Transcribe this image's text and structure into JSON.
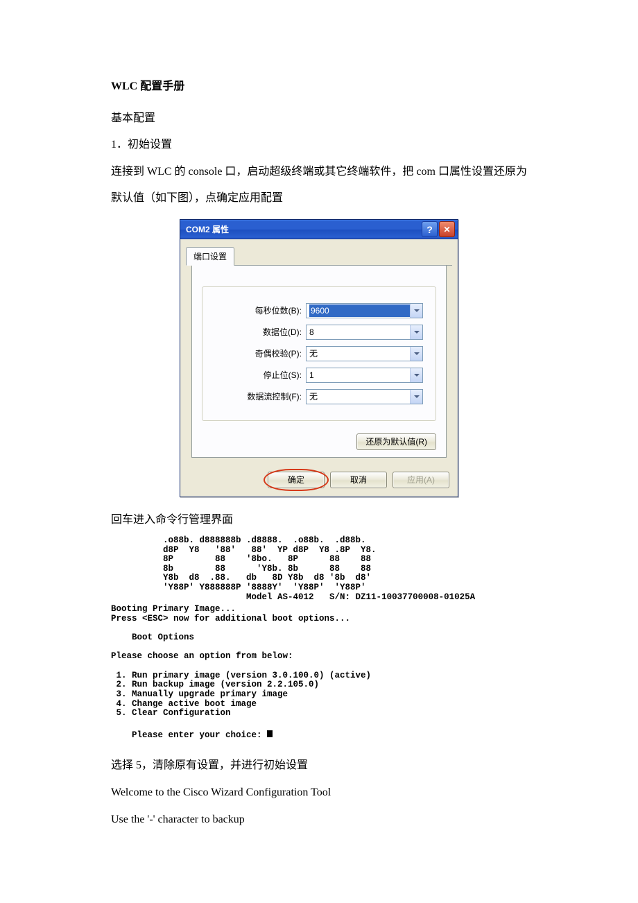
{
  "doc": {
    "title": "WLC 配置手册",
    "section": "基本配置",
    "step1": "1．初始设置",
    "intro": "连接到 WLC 的 console 口，启动超级终端或其它终端软件，把 com 口属性设置还原为默认值（如下图），点确定应用配置",
    "after_dialog": "回车进入命令行管理界面",
    "choose5": "选择 5，清除原有设置，并进行初始设置",
    "welcome": "Welcome to the Cisco Wizard Configuration Tool",
    "backup_hint": "Use the '-' character to backup"
  },
  "dialog": {
    "title": "COM2 属性",
    "tab": "端口设置",
    "fields": {
      "baud_label": "每秒位数(B):",
      "baud_value": "9600",
      "databits_label": "数据位(D):",
      "databits_value": "8",
      "parity_label": "奇偶校验(P):",
      "parity_value": "无",
      "stopbits_label": "停止位(S):",
      "stopbits_value": "1",
      "flow_label": "数据流控制(F):",
      "flow_value": "无"
    },
    "restore": "还原为默认值(R)",
    "ok": "确定",
    "cancel": "取消",
    "apply": "应用(A)",
    "help_glyph": "?",
    "close_glyph": "✕"
  },
  "boot": {
    "ascii": "          .o88b. d888888b .d8888.  .o88b.  .d88b.\n          d8P  Y8   '88'   88'  YP d8P  Y8 .8P  Y8.\n          8P        88    '8bo.   8P      88    88\n          8b        88      'Y8b. 8b      88    88\n          Y8b  d8  .88.   db   8D Y8b  d8 '8b  d8'\n          'Y88P' Y888888P '8888Y'  'Y88P'  'Y88P'\n                          Model AS-4012   S/N: DZ11-10037700008-01025A",
    "body": "Booting Primary Image...\nPress <ESC> now for additional boot options...\n\n    Boot Options\n\nPlease choose an option from below:\n\n 1. Run primary image (version 3.0.100.0) (active)\n 2. Run backup image (version 2.2.105.0)\n 3. Manually upgrade primary image\n 4. Change active boot image\n 5. Clear Configuration\n",
    "prompt": "Please enter your choice: "
  }
}
